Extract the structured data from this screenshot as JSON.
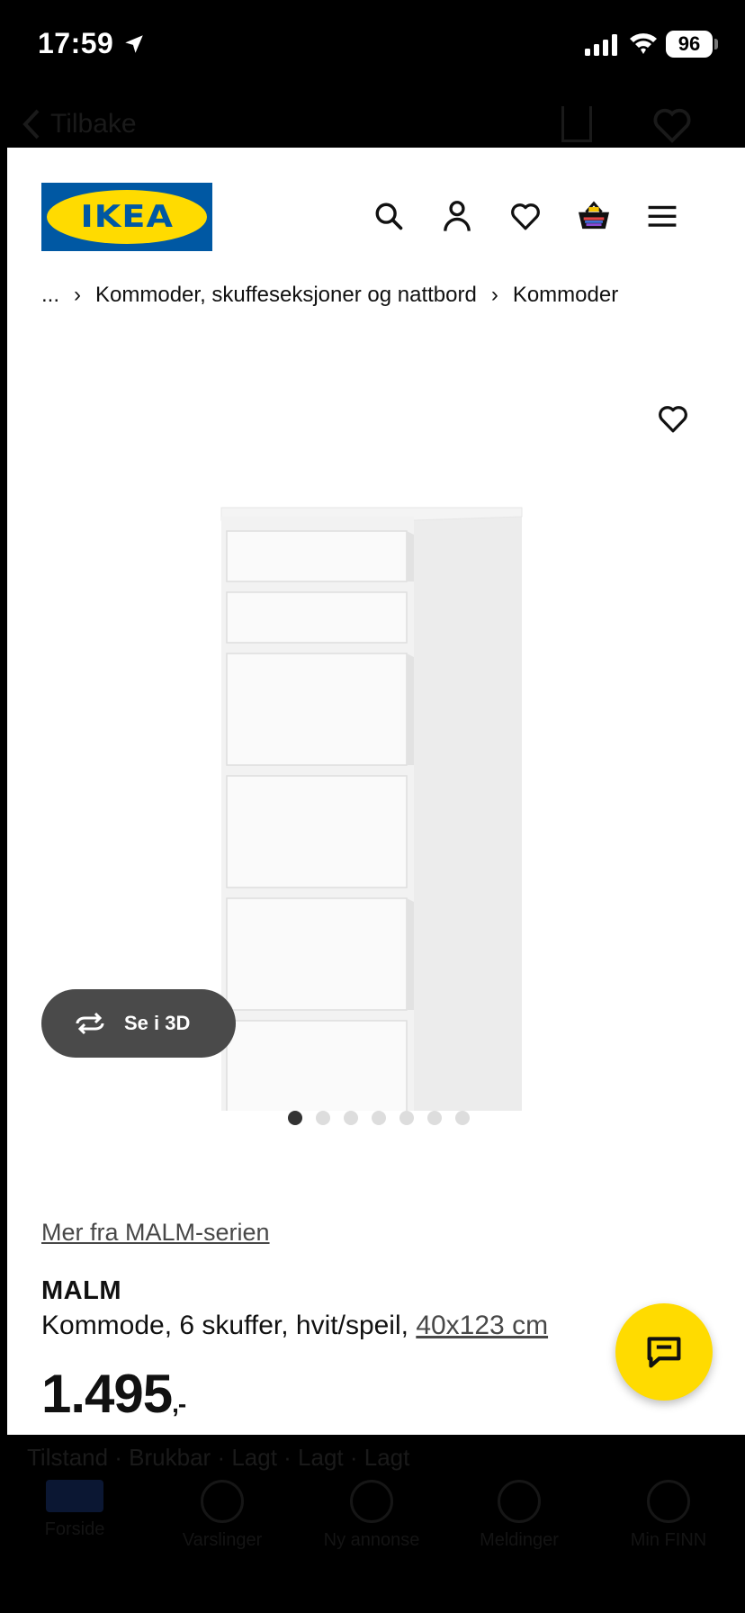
{
  "status_bar": {
    "time": "17:59",
    "battery": "96"
  },
  "under_nav": {
    "back_label": "Tilbake"
  },
  "header": {
    "logo_text": "IKEA"
  },
  "breadcrumb": {
    "ellipsis": "...",
    "items": [
      "Kommoder, skuffeseksjoner og nattbord",
      "Kommoder"
    ]
  },
  "product": {
    "view_3d_label": "Se i 3D",
    "image_count": 7,
    "active_image_index": 0,
    "series_link": "Mer fra MALM-serien",
    "name": "MALM",
    "description": "Kommode, 6 skuffer, hvit/speil, ",
    "dimensions": "40x123 cm",
    "price": "1.495",
    "price_suffix": ",-"
  },
  "under_bottom": {
    "toast_text": "Tilstand · Brukbar · Lagt · Lagt · Lagt",
    "tabs": [
      "Forside",
      "Varslinger",
      "Ny annonse",
      "Meldinger",
      "Min FINN"
    ]
  },
  "colors": {
    "ikea_blue": "#0058a3",
    "ikea_yellow": "#ffdb00",
    "button_dark": "#4a4a4a"
  }
}
